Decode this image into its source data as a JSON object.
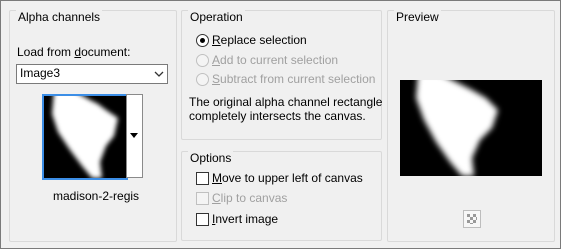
{
  "alpha_channels": {
    "title": "Alpha channels",
    "load_label_pre": "Load from ",
    "load_label_ul": "d",
    "load_label_post": "ocument:",
    "document_value": "Image3",
    "channel_name": "madison-2-regis"
  },
  "operation": {
    "title": "Operation",
    "replace_ul": "R",
    "replace_rest": "eplace selection",
    "add_ul": "A",
    "add_rest": "dd to current selection",
    "subtract_ul": "S",
    "subtract_rest": "ubtract from current selection",
    "description_line1": "The original alpha channel rectangle",
    "description_line2": "completely intersects the canvas."
  },
  "options": {
    "title": "Options",
    "move_ul": "M",
    "move_rest": "ove to upper left of canvas",
    "clip_ul": "C",
    "clip_rest": "lip to canvas",
    "invert_ul": "I",
    "invert_rest": "nvert image"
  },
  "preview": {
    "title": "Preview"
  },
  "icons": {
    "thumbnail": "alpha-channel-thumbnail",
    "preview": "preview-image",
    "preview_toggle": "checker-preview-icon"
  },
  "colors": {
    "selection_border": "#3c8ee6",
    "mask_black": "#000000",
    "mask_white": "#ffffff"
  }
}
